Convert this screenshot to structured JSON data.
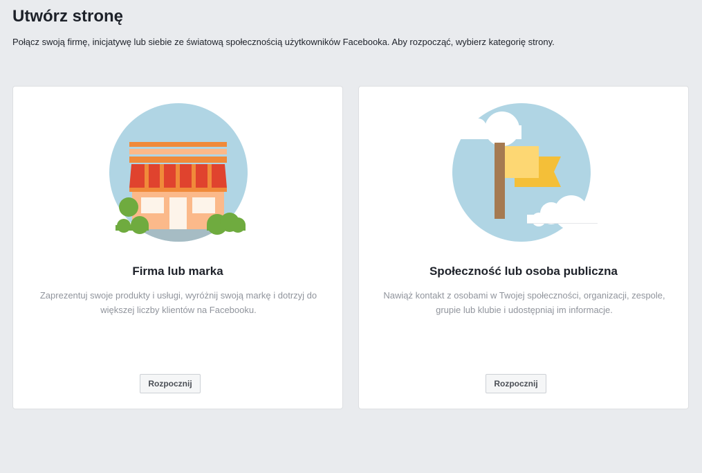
{
  "header": {
    "title": "Utwórz stronę",
    "subtitle": "Połącz swoją firmę, inicjatywę lub siebie ze światową społecznością użytkowników Facebooka. Aby rozpocząć, wybierz kategorię strony."
  },
  "cards": [
    {
      "title": "Firma lub marka",
      "description": "Zaprezentuj swoje produkty i usługi, wyróżnij swoją markę i dotrzyj do większej liczby klientów na Facebooku.",
      "button_label": "Rozpocznij",
      "icon": "storefront-illustration"
    },
    {
      "title": "Społeczność lub osoba publiczna",
      "description": "Nawiąż kontakt z osobami w Twojej społeczności, organizacji, zespole, grupie lub klubie i udostępniaj im informacje.",
      "button_label": "Rozpocznij",
      "icon": "flag-illustration"
    }
  ],
  "colors": {
    "page_background": "#e9ebee",
    "card_background": "#ffffff",
    "circle": "#b0d5e4",
    "awning_red": "#e0432e",
    "awning_orange": "#f08a3a",
    "wall_peach": "#fbb98a",
    "bush_green": "#6fab3f",
    "flag_yellow": "#fdd773",
    "flag_gold": "#f4bf38",
    "pole_brown": "#a57a51"
  }
}
